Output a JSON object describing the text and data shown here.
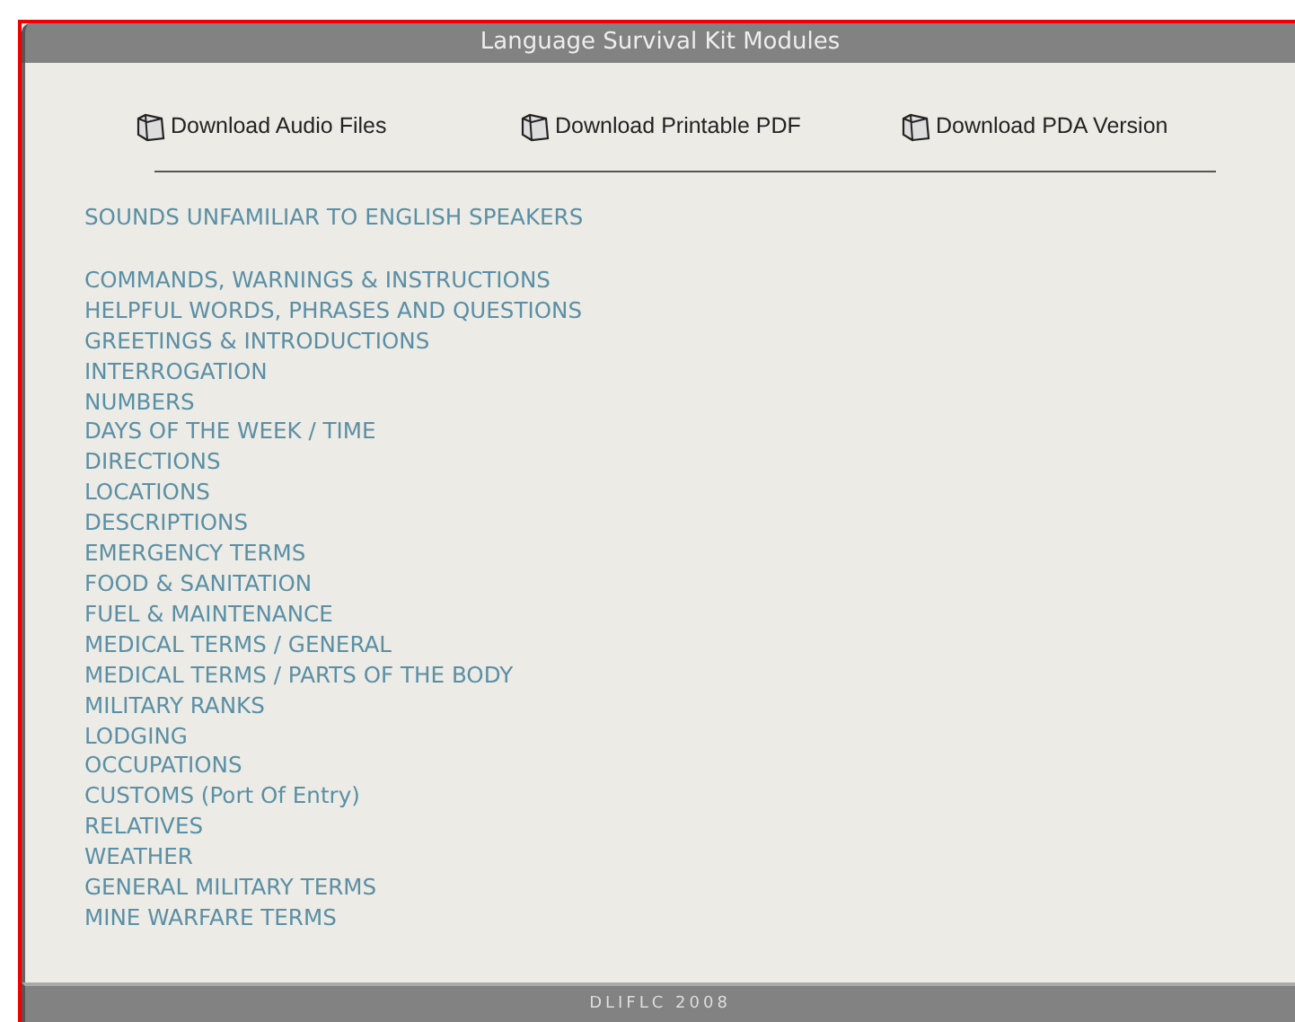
{
  "window": {
    "title": "Language Survival Kit Modules"
  },
  "downloads": [
    {
      "label": "Download Audio Files"
    },
    {
      "label": "Download Printable PDF"
    },
    {
      "label": "Download PDA Version"
    }
  ],
  "featured_module": "SOUNDS UNFAMILIAR TO ENGLISH SPEAKERS",
  "modules": [
    "COMMANDS, WARNINGS & INSTRUCTIONS",
    "HELPFUL WORDS, PHRASES AND QUESTIONS",
    "GREETINGS & INTRODUCTIONS",
    "INTERROGATION",
    "NUMBERS",
    "DAYS OF THE WEEK / TIME",
    "DIRECTIONS",
    "LOCATIONS",
    "DESCRIPTIONS",
    "EMERGENCY TERMS",
    "FOOD & SANITATION",
    "FUEL & MAINTENANCE",
    "MEDICAL TERMS / GENERAL",
    "MEDICAL TERMS / PARTS OF THE BODY",
    "MILITARY RANKS",
    "LODGING",
    "OCCUPATIONS",
    "CUSTOMS (Port Of Entry)",
    "RELATIVES",
    "WEATHER",
    "GENERAL MILITARY TERMS",
    "MINE WARFARE TERMS"
  ],
  "footer": "DLIFLC 2008"
}
